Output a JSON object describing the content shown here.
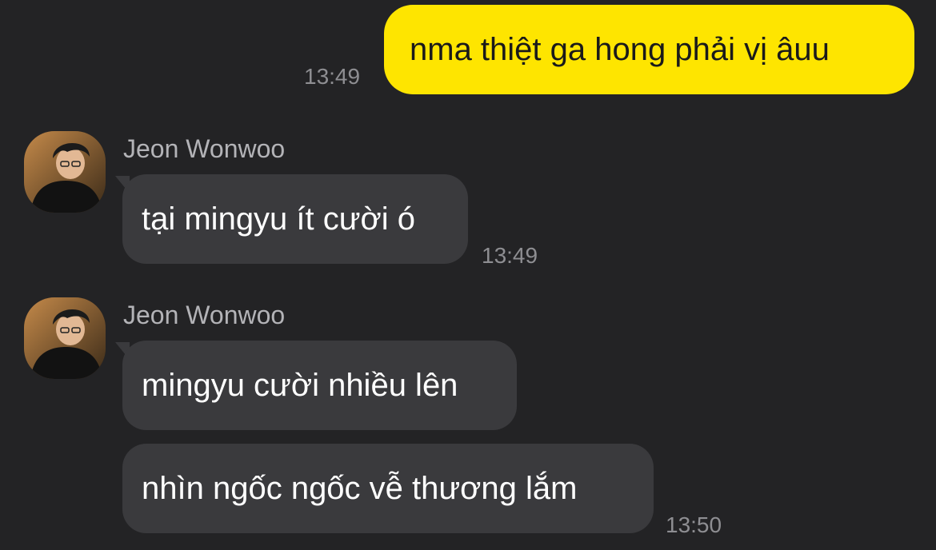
{
  "conversation": {
    "outgoing": {
      "text": "nma thiệt ga hong phải vị âuu",
      "time": "13:49"
    },
    "groups": [
      {
        "sender": "Jeon Wonwoo",
        "avatar_icon": "profile-photo",
        "messages": [
          {
            "text": "tại mingyu ít cười ó"
          }
        ],
        "time": "13:49"
      },
      {
        "sender": "Jeon Wonwoo",
        "avatar_icon": "profile-photo",
        "messages": [
          {
            "text": "mingyu cười nhiều lên"
          },
          {
            "text": "nhìn ngốc ngốc vễ thương lắm"
          }
        ],
        "time": "13:50"
      }
    ]
  },
  "colors": {
    "background": "#232325",
    "outgoing_bubble": "#fee500",
    "incoming_bubble": "#3a3a3d",
    "timestamp": "#8e8e92",
    "sender_name": "#b3b3b7"
  }
}
